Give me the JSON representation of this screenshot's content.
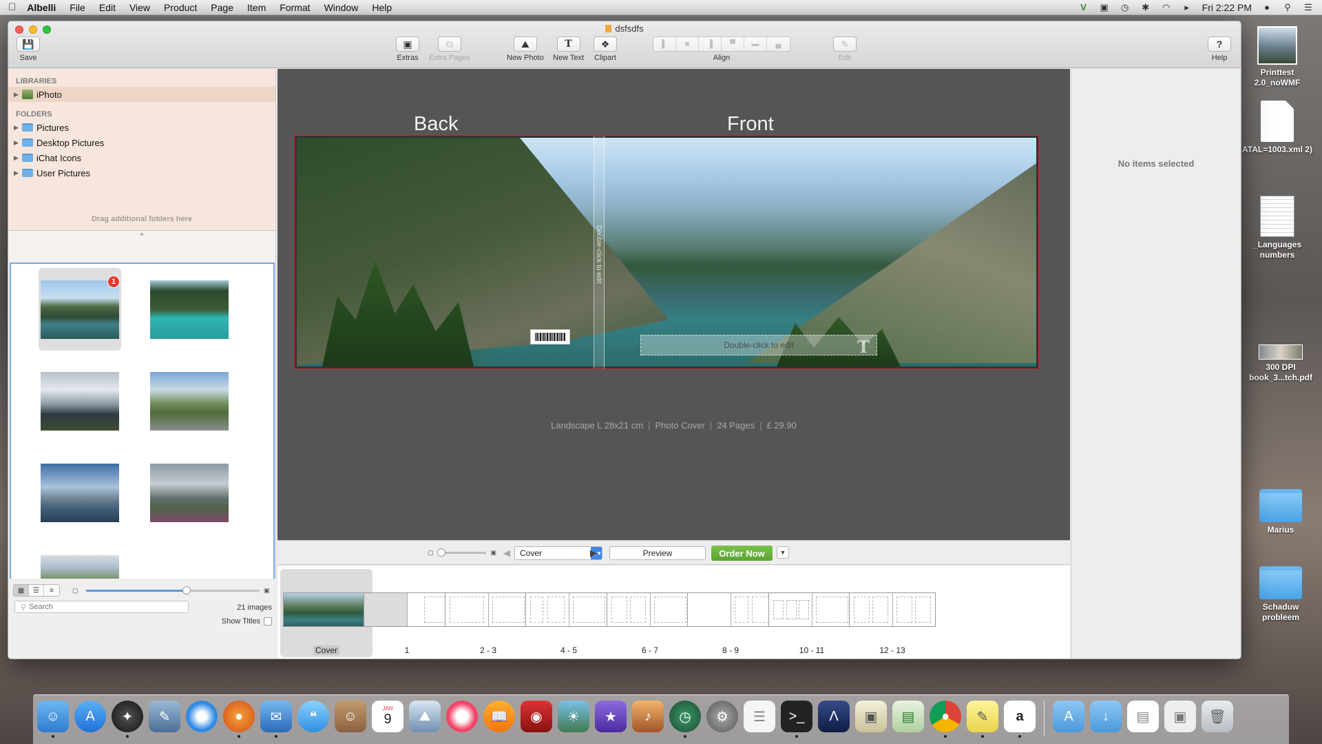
{
  "menubar": {
    "apple": "",
    "app_name": "Albelli",
    "items": [
      "File",
      "Edit",
      "View",
      "Product",
      "Page",
      "Item",
      "Format",
      "Window",
      "Help"
    ],
    "clock": "Fri 2:22 PM",
    "status_icons": [
      "vpn-icon",
      "screen-mirror-icon",
      "time-machine-icon",
      "bluetooth-icon",
      "wifi-icon",
      "volume-icon",
      "user-icon",
      "spotlight-icon",
      "list-icon"
    ]
  },
  "window": {
    "title": "dsfsdfs",
    "toolbar": {
      "save": "Save",
      "extras": "Extras",
      "extra_pages": "Extra Pages",
      "new_photo": "New Photo",
      "new_text": "New Text",
      "clipart": "Clipart",
      "align": "Align",
      "edit": "Edit",
      "help": "Help"
    }
  },
  "sidebar": {
    "libraries_heading": "LIBRARIES",
    "libraries": [
      "iPhoto"
    ],
    "folders_heading": "FOLDERS",
    "folders": [
      "Pictures",
      "Desktop Pictures",
      "iChat Icons",
      "User Pictures"
    ],
    "drag_hint": "Drag additional folders here",
    "photo_badge": "1",
    "search_placeholder": "Search",
    "image_count": "21 images",
    "show_titles": "Show Titles",
    "thumb_zoom": 0.58
  },
  "canvas": {
    "back_label": "Back",
    "front_label": "Front",
    "spine_hint": "Double-click to edit",
    "text_hint": "Double-click to edit",
    "text_icon": "T",
    "info": [
      "Landscape L 28x21 cm",
      "Photo Cover",
      "24 Pages",
      "£ 29.90"
    ],
    "info_sep": "|"
  },
  "controls": {
    "page_selected": "Cover",
    "preview": "Preview",
    "order_now": "Order Now",
    "prev_arrow": "◀",
    "next_arrow": "▶",
    "canvas_zoom": 0
  },
  "filmstrip": {
    "pages": [
      "Cover",
      "1",
      "2 - 3",
      "4 - 5",
      "6 - 7",
      "8 - 9",
      "10 - 11",
      "12 - 13"
    ]
  },
  "inspector": {
    "empty_text": "No items selected"
  },
  "desktop": {
    "items": [
      {
        "label": "Printtest 2.0_noWMF"
      },
      {
        "label": "ATAL=1003.xml 2)"
      },
      {
        "label": "_Languages numbers"
      },
      {
        "label": "300 DPI book_3...tch.pdf"
      },
      {
        "label": "Marius"
      },
      {
        "label": "Schaduw probleem"
      }
    ]
  },
  "dock": {
    "apps": [
      "finder-icon",
      "app-store-icon",
      "launchpad-icon",
      "preview-icon",
      "safari-icon",
      "firefox-icon",
      "mail-icon",
      "messages-icon",
      "contacts-icon",
      "calendar-icon",
      "photos-icon",
      "itunes-icon",
      "ibooks-icon",
      "photo-booth-icon",
      "iphoto-icon",
      "imovie-icon",
      "garageband-icon",
      "time-machine-icon",
      "system-preferences-icon",
      "textedit-icon",
      "terminal-icon",
      "instruments-icon",
      "preview-2-icon",
      "numbers-icon",
      "chrome-icon",
      "stickies-icon",
      "albelli-icon"
    ],
    "calendar_month": "JAN",
    "calendar_day": "9"
  },
  "colors": {
    "accent": "#3f88e6",
    "order_green": "#59a52f",
    "selection_border": "#c0302a",
    "badge_red": "#e8362c"
  }
}
